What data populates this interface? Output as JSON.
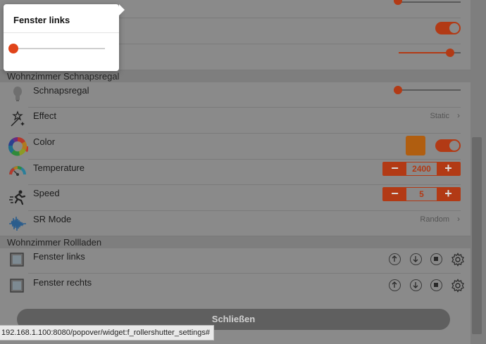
{
  "popover": {
    "title": "Fenster links",
    "slider_fraction": 0.0,
    "accent": "#e0441a"
  },
  "groups": [
    {
      "title": "Wohnzimmer Schnapsregal"
    },
    {
      "title": "Wohnzimmer Rollladen"
    }
  ],
  "items": {
    "schnapsregal": {
      "label": "Schnapsregal",
      "slider_fraction": 0.0
    },
    "effect": {
      "label": "Effect",
      "value": "Static"
    },
    "color": {
      "label": "Color",
      "swatch": "#b05e10",
      "toggle": true
    },
    "temperature": {
      "label": "Temperature",
      "value": "2400"
    },
    "speed": {
      "label": "Speed",
      "value": "5"
    },
    "sr_mode": {
      "label": "SR Mode",
      "value": "Random"
    },
    "fenster_links": {
      "label": "Fenster links"
    },
    "fenster_rechts": {
      "label": "Fenster rechts"
    }
  },
  "top_rows": {
    "toggle_on": true,
    "slider_fraction": 0.85
  },
  "close_button": {
    "label": "Schließen"
  },
  "status_url": "192.168.1.100:8080/popover/widget:f_rollershutter_settings#",
  "colors": {
    "accent": "#b23a15",
    "overlay": "#8a8a8a"
  }
}
